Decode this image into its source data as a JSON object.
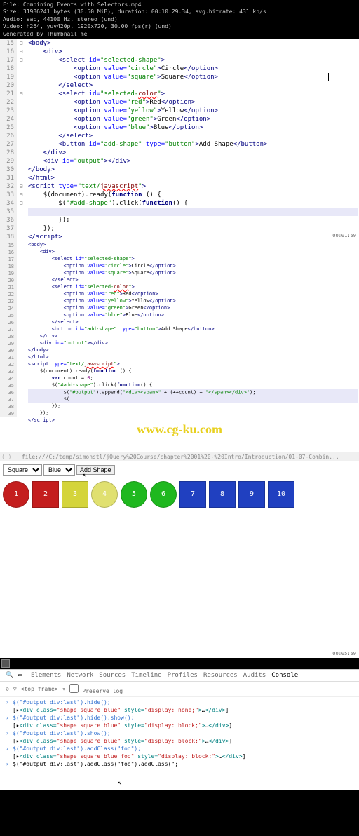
{
  "video_info": {
    "line1": "File: Combining Events with Selectors.mp4",
    "line2": "Size: 31986241 bytes (30.50 MiB), duration: 00:10:29.34, avg.bitrate: 431 kb/s",
    "line3": "Audio: aac, 44100 Hz, stereo (und)",
    "line4": "Video: h264, yuv420p, 1920x720, 30.00 fps(r) (und)",
    "line5": "Generated by Thumbnail me"
  },
  "code1": {
    "lines": [
      "15",
      "16",
      "17",
      "18",
      "19",
      "20",
      "21",
      "22",
      "23",
      "24",
      "25",
      "26",
      "27",
      "28",
      "29",
      "30",
      "31",
      "32",
      "33",
      "34",
      "35",
      "36",
      "37",
      "38"
    ]
  },
  "code2": {
    "lines": [
      "15",
      "16",
      "17",
      "18",
      "19",
      "20",
      "21",
      "22",
      "23",
      "24",
      "25",
      "26",
      "27",
      "28",
      "29",
      "30",
      "31",
      "32",
      "33",
      "34",
      "35",
      "36",
      "37",
      "38",
      "39"
    ]
  },
  "timestamps": {
    "t1": "00:01:59",
    "t2": "00:05:59"
  },
  "watermark": "www.cg-ku.com",
  "browser_path": "file:///C:/temp/simonstl/jQuery%20Course/chapter%2001%20-%20Intro/Introduction/01-07-Combin...",
  "preview": {
    "shape_select": "Square",
    "color_select": "Blue",
    "add_btn": "Add Shape",
    "shapes": [
      {
        "n": "1",
        "cls": "circle red"
      },
      {
        "n": "2",
        "cls": "square red"
      },
      {
        "n": "3",
        "cls": "square yellow"
      },
      {
        "n": "4",
        "cls": "circle ylw-light"
      },
      {
        "n": "5",
        "cls": "circle green"
      },
      {
        "n": "6",
        "cls": "circle green"
      },
      {
        "n": "7",
        "cls": "square blue"
      },
      {
        "n": "8",
        "cls": "square blue"
      },
      {
        "n": "9",
        "cls": "square blue"
      },
      {
        "n": "10",
        "cls": "square blue"
      }
    ]
  },
  "devtools": {
    "tabs": [
      "Elements",
      "Network",
      "Sources",
      "Timeline",
      "Profiles",
      "Resources",
      "Audits",
      "Console"
    ],
    "active_tab": "Console",
    "frame": "<top frame>",
    "preserve_log": "Preserve log",
    "console": [
      {
        "type": "cmd",
        "text": "$(\"#output div:last\").hide();"
      },
      {
        "type": "out",
        "text": "[▸<div class=\"shape square blue\" style=\"display: none;\">…</div>]"
      },
      {
        "type": "cmd",
        "text": "$(\"#output div:last\").hide().show();"
      },
      {
        "type": "out",
        "text": "[▸<div class=\"shape square blue\" style=\"display: block;\">…</div>]"
      },
      {
        "type": "cmd",
        "text": "$(\"#output div:last\").show();"
      },
      {
        "type": "out",
        "text": "[▸<div class=\"shape square blue\" style=\"display: block;\">…</div>]"
      },
      {
        "type": "cmd",
        "text": "$(\"#output div:last\").addClass(\"foo\");"
      },
      {
        "type": "out",
        "text": "[▸<div class=\"shape square blue foo\" style=\"display: block;\">…</div>]"
      },
      {
        "type": "cmd",
        "text": "$(\"#output div:last\").addClass(\"foo\").addClass(\";"
      }
    ]
  }
}
